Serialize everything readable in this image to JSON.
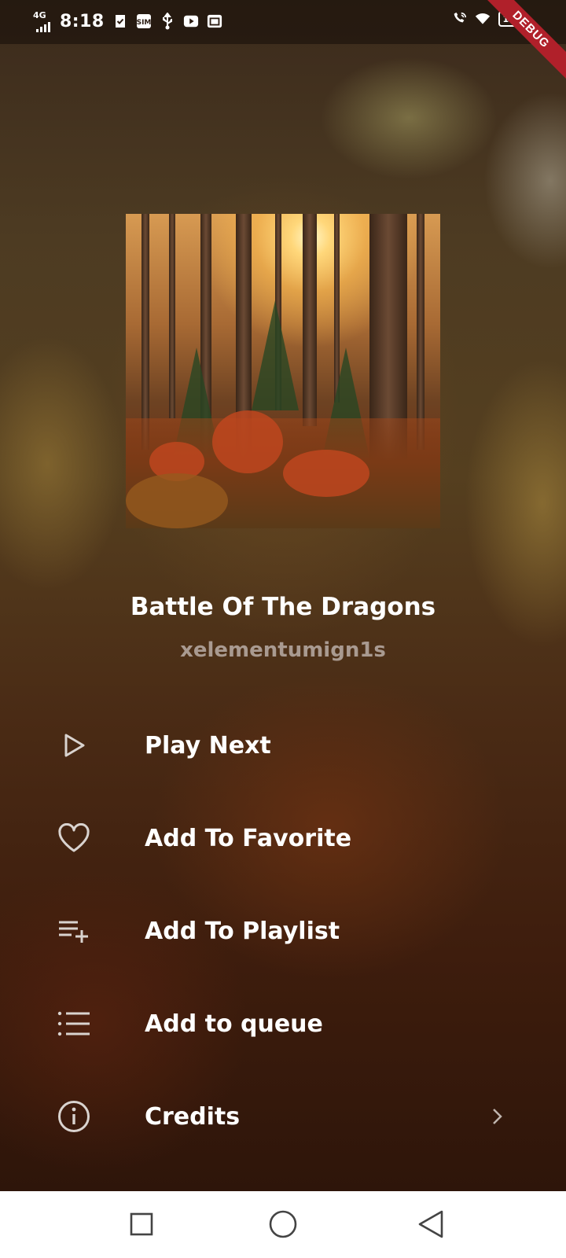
{
  "status_bar": {
    "network": "4G",
    "time": "8:18",
    "battery": "100",
    "icons": [
      "check-shield-icon",
      "sim-icon",
      "usb-icon",
      "youtube-icon",
      "mail-icon"
    ],
    "right_icons": [
      "wifi-call-icon",
      "wifi-icon",
      "battery-icon"
    ]
  },
  "debug_banner": "DEBUG",
  "song": {
    "title": "Battle Of The Dragons",
    "artist": "xelementumign1s"
  },
  "menu": {
    "items": [
      {
        "label": "Play Next",
        "icon": "play-outline-icon"
      },
      {
        "label": "Add To Favorite",
        "icon": "heart-outline-icon"
      },
      {
        "label": "Add To Playlist",
        "icon": "playlist-add-icon"
      },
      {
        "label": "Add to queue",
        "icon": "list-icon"
      },
      {
        "label": "Credits",
        "icon": "info-icon",
        "trailing": "chevron-right-icon"
      }
    ]
  },
  "nav_bar": {
    "buttons": [
      "recents-square-icon",
      "home-circle-icon",
      "back-triangle-icon"
    ]
  },
  "colors": {
    "accent_debug": "#b0202a",
    "text_primary": "#ffffff",
    "text_secondary": "#c8beb9",
    "navbar_bg": "#ffffff"
  }
}
